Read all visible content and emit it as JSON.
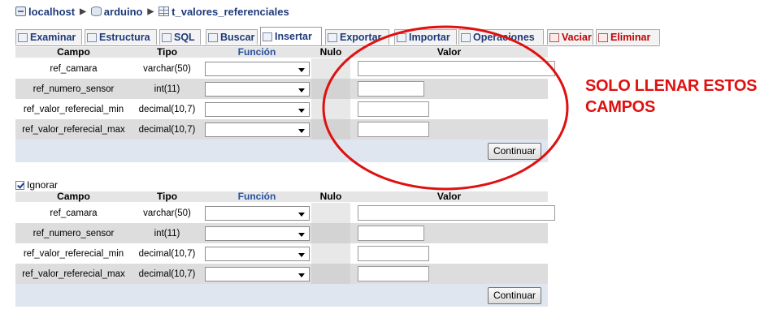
{
  "breadcrumb": [
    {
      "label": "localhost",
      "icon": "server-icon"
    },
    {
      "label": "arduino",
      "icon": "database-icon"
    },
    {
      "label": "t_valores_referenciales",
      "icon": "table-icon"
    }
  ],
  "tabs": [
    {
      "label": "Examinar",
      "icon": "browse-icon",
      "active": false,
      "danger": false
    },
    {
      "label": "Estructura",
      "icon": "structure-icon",
      "active": false,
      "danger": false
    },
    {
      "label": "SQL",
      "icon": "sql-icon",
      "active": false,
      "danger": false
    },
    {
      "label": "Buscar",
      "icon": "search-icon",
      "active": false,
      "danger": false
    },
    {
      "label": "Insertar",
      "icon": "insert-icon",
      "active": true,
      "danger": false
    },
    {
      "label": "Exportar",
      "icon": "export-icon",
      "active": false,
      "danger": false
    },
    {
      "label": "Importar",
      "icon": "import-icon",
      "active": false,
      "danger": false
    },
    {
      "label": "Operaciones",
      "icon": "operations-icon",
      "active": false,
      "danger": false
    },
    {
      "label": "Vaciar",
      "icon": "empty-icon",
      "active": false,
      "danger": true
    },
    {
      "label": "Eliminar",
      "icon": "drop-icon",
      "active": false,
      "danger": true
    }
  ],
  "table": {
    "headers": {
      "campo": "Campo",
      "tipo": "Tipo",
      "funcion": "Función",
      "nulo": "Nulo",
      "valor": "Valor"
    },
    "rows": [
      {
        "campo": "ref_camara",
        "tipo": "varchar(50)",
        "funcion": "",
        "valor": ""
      },
      {
        "campo": "ref_numero_sensor",
        "tipo": "int(11)",
        "funcion": "",
        "valor": ""
      },
      {
        "campo": "ref_valor_referecial_min",
        "tipo": "decimal(10,7)",
        "funcion": "",
        "valor": ""
      },
      {
        "campo": "ref_valor_referecial_max",
        "tipo": "decimal(10,7)",
        "funcion": "",
        "valor": ""
      }
    ],
    "continue_label": "Continuar"
  },
  "ignore": {
    "label": "Ignorar",
    "checked": true
  },
  "annotation": {
    "line1": "SOLO LLENAR ESTOS",
    "line2": "CAMPOS",
    "color": "#e01010"
  }
}
